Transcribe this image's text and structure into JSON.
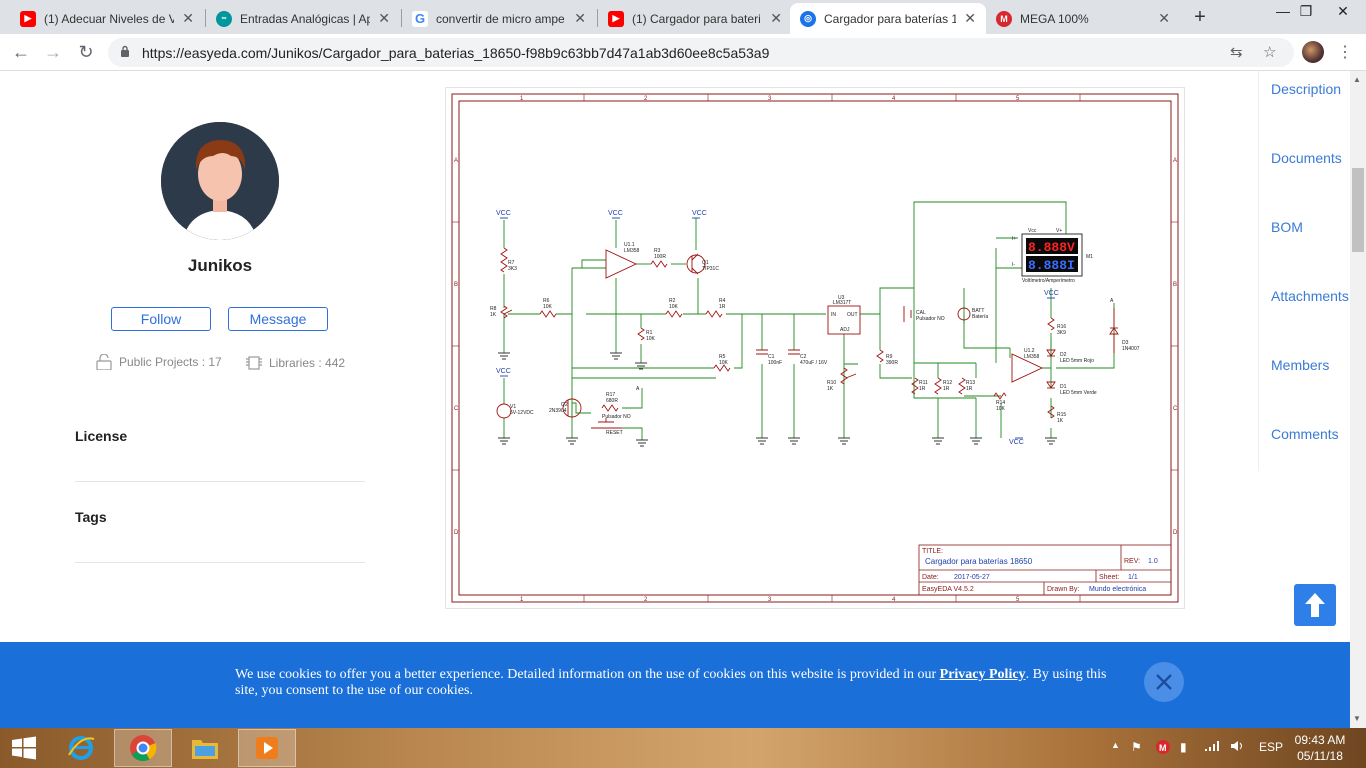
{
  "browser": {
    "tabs": [
      {
        "title": "(1) Adecuar Niveles de V",
        "icon": "youtube-icon",
        "color": "#ff0000",
        "active": false
      },
      {
        "title": "Entradas Analógicas | Ap",
        "icon": "arduino-icon",
        "color": "#00979c",
        "active": false
      },
      {
        "title": "convertir de micro ampe",
        "icon": "google-icon",
        "color": "#4285f4",
        "active": false
      },
      {
        "title": "(1) Cargador para bateri",
        "icon": "youtube-icon",
        "color": "#ff0000",
        "active": false
      },
      {
        "title": "Cargador para baterías 1",
        "icon": "easyeda-icon",
        "color": "#1a73e8",
        "active": true
      },
      {
        "title": "MEGA 100%",
        "icon": "mega-icon",
        "color": "#d9272e",
        "active": false
      }
    ],
    "url": "https://easyeda.com/Junikos/Cargador_para_baterias_18650-f98b9c63bb7d47a1ab3d60ee8c5a53a9"
  },
  "profile": {
    "username": "Junikos",
    "follow_label": "Follow",
    "message_label": "Message",
    "public_projects": "Public Projects : 17",
    "libraries": "Libraries : 442"
  },
  "sections": {
    "license": "License",
    "tags": "Tags"
  },
  "sidenav": [
    "Description",
    "Documents",
    "BOM",
    "Attachments",
    "Members",
    "Comments"
  ],
  "schematic": {
    "title_label": "TITLE:",
    "title": "Cargador para baterías 18650",
    "rev_label": "REV:",
    "rev": "1.0",
    "date_label": "Date:",
    "date": "2017-05-27",
    "sheet_label": "Sheet:",
    "sheet": "1/1",
    "tool": "EasyEDA V4.5.2",
    "drawn_label": "Drawn By:",
    "drawn": "Mundo electrónica",
    "col_labels": [
      "1",
      "2",
      "3",
      "4",
      "5"
    ],
    "row_labels": [
      "A",
      "B",
      "C",
      "D"
    ],
    "labels": {
      "vcc": "VCC",
      "r7": "R7",
      "r7v": "3K3",
      "r8": "R8",
      "r8v": "1K",
      "r6": "R6",
      "r6v": "10K",
      "u11": "U1.1",
      "u11v": "LM358",
      "r3": "R3",
      "r3v": "100R",
      "q1": "Q1",
      "q1v": "TIP31C",
      "r2": "R2",
      "r2v": "10K",
      "r4": "R4",
      "r4v": "1R",
      "r1": "R1",
      "r1v": "10K",
      "r5": "R5",
      "r5v": "10K",
      "v1": "V1",
      "v1v": "5V-12VDC",
      "q2": "Q2",
      "q2v": "2N3904",
      "r17": "R17",
      "r17v": "680R",
      "sw_reset": "Pulsador NO",
      "reset": "RESET",
      "c1": "C1",
      "c1v": "100nF",
      "c2": "C2",
      "c2v": "470uF / 16V",
      "u3": "U3",
      "u3v": "LM317T",
      "in": "IN",
      "out": "OUT",
      "adj": "ADJ",
      "r10": "R10",
      "r10v": "1K",
      "r9": "R9",
      "r9v": "390R",
      "cal": "CAL",
      "cal2": "Pulsador NO",
      "batt": "BATT",
      "batt2": "Batería",
      "vin": "Vcc",
      "vplus": "V+",
      "meter_top": "8.888V",
      "meter_bot": "8.888I",
      "m1": "M1",
      "meter_name": "Voltímetro/Amperímetro",
      "i_plus": "I+",
      "i_minus": "I-",
      "r11": "R11",
      "r11v": "1R",
      "r12": "R12",
      "r12v": "1R",
      "r13": "R13",
      "r13v": "1R",
      "r14": "R14",
      "r14v": "10K",
      "u12": "U1.2",
      "u12v": "LM358",
      "r16": "R16",
      "r16v": "3K9",
      "d2": "D2",
      "d2v": "LED 5mm Rojo",
      "d1": "D1",
      "d1v": "LED 5mm Verde",
      "r15": "R15",
      "r15v": "1K",
      "d3": "D3",
      "d3v": "1N4007",
      "a": "A"
    }
  },
  "cookie": {
    "text_before": "We use cookies to offer you a better experience. Detailed information on the use of cookies on this website is provided in our ",
    "link": "Privacy Policy",
    "text_after": ". By using this site, you consent to the use of our cookies."
  },
  "taskbar": {
    "lang": "ESP",
    "time": "09:43 AM",
    "date": "05/11/18"
  }
}
